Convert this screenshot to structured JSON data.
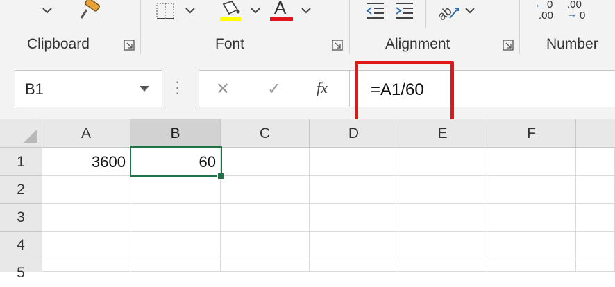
{
  "ribbon": {
    "groups": {
      "clipboard": "Clipboard",
      "font": "Font",
      "alignment": "Alignment",
      "number": "Number"
    },
    "icons": [
      "dropdown-chevron-icon",
      "format-painter-icon",
      "borders-icon",
      "fill-color-icon",
      "font-color-icon",
      "decrease-indent-icon",
      "increase-indent-icon",
      "orientation-icon",
      "increase-decimal-icon",
      "decrease-decimal-icon",
      "dialog-launcher-icon"
    ],
    "font_color_letter": "A",
    "decimal_labels": {
      "increase": ".00",
      "decrease": ".00",
      "small_zero_left": "0",
      "small_zero_right": "0",
      "arrow_left": "←",
      "arrow_right": "→"
    },
    "colors": {
      "fill_color": "#ffff00",
      "font_color": "#e0161b"
    }
  },
  "formula_bar": {
    "name_box": "B1",
    "formula": "=A1/60",
    "cancel_glyph": "✕",
    "enter_glyph": "✓",
    "fx_label": "fx"
  },
  "sheet": {
    "columns": [
      "A",
      "B",
      "C",
      "D",
      "E",
      "F"
    ],
    "rows": [
      "1",
      "2",
      "3",
      "4",
      "5"
    ],
    "cells": {
      "A1": "3600",
      "B1": "60"
    },
    "selected_cell": "B1"
  },
  "colors": {
    "accent_green": "#217346",
    "highlight_red": "#e0161b"
  }
}
